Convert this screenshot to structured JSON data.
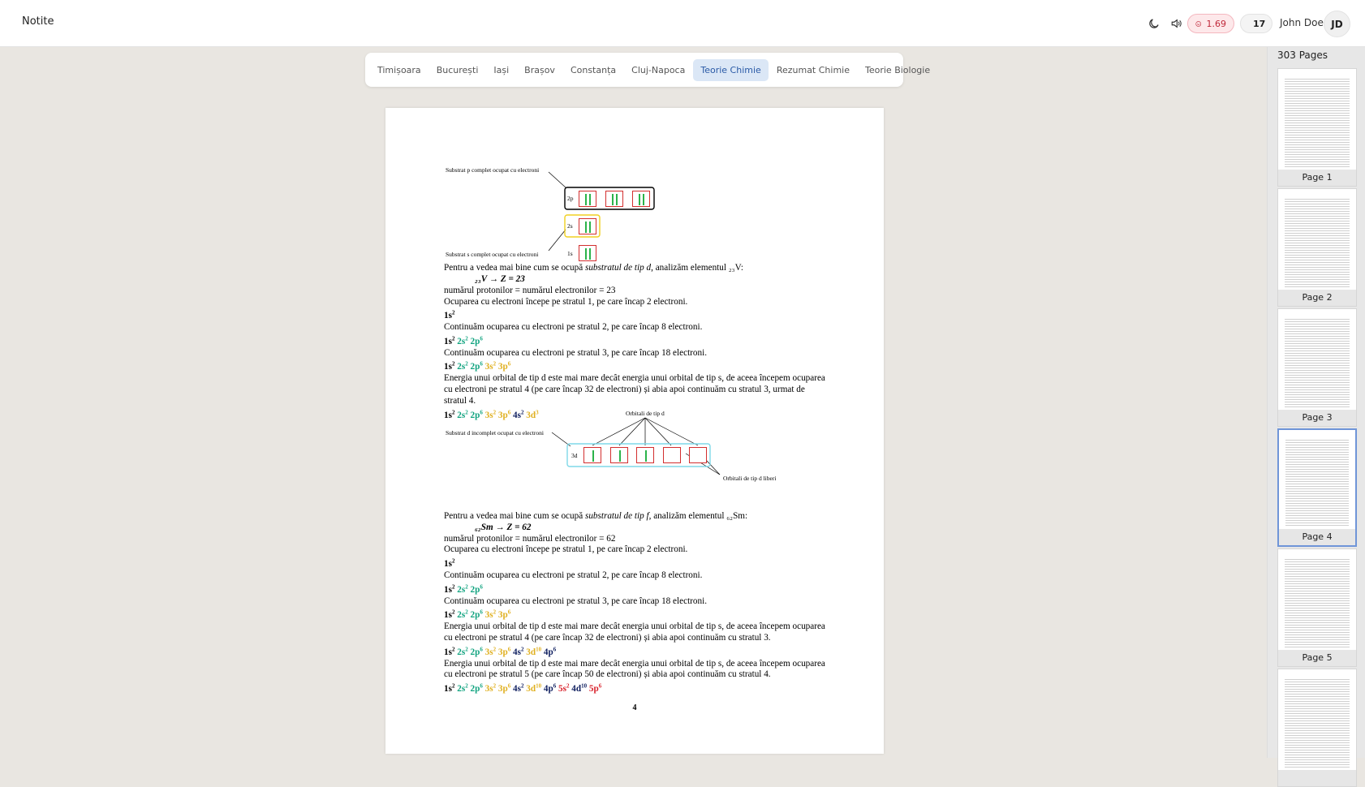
{
  "header": {
    "app_title": "Notite",
    "score": "1.69",
    "count": "17",
    "user_name": "John Doe",
    "user_initials": "JD",
    "icons": [
      "moon-icon",
      "speaker-icon",
      "sad-face-icon",
      "grid-icon"
    ]
  },
  "tabs": [
    {
      "label": "Timișoara",
      "active": false
    },
    {
      "label": "București",
      "active": false
    },
    {
      "label": "Iași",
      "active": false
    },
    {
      "label": "Brașov",
      "active": false
    },
    {
      "label": "Constanța",
      "active": false
    },
    {
      "label": "Cluj-Napoca",
      "active": false
    },
    {
      "label": "Teorie Chimie",
      "active": true
    },
    {
      "label": "Rezumat Chimie",
      "active": false
    },
    {
      "label": "Teorie Biologie",
      "active": false
    }
  ],
  "document": {
    "page_number": "4",
    "diagram1": {
      "label_p": "Substrat p complet ocupat cu electroni",
      "label_s": "Substrat s complet ocupat cu electroni",
      "sub_2p": "2p",
      "sub_2s": "2s",
      "sub_1s": "1s"
    },
    "diagram2": {
      "label_top": "Orbitali de tip d",
      "label_left": "Substrat d incomplet ocupat cu electroni",
      "label_right": "Orbitali de tip d liberi",
      "sub_3d": "3d"
    },
    "block1": {
      "intro_pre": "Pentru a vedea mai bine cum se ocupă ",
      "intro_em": "substratul de tip d",
      "intro_post": ", analizăm elementul ₂₃V:",
      "formula": "₂₃V → Z = 23",
      "protons": "numărul protonilor = numărul electronilor = 23",
      "s1": "Ocuparea cu electroni începe pe stratul 1, pe care încap 2 electroni.",
      "s2": "Continuăm ocuparea cu electroni pe stratul 2, pe care încap 8 electroni.",
      "s3": "Continuăm ocuparea cu electroni pe stratul 3, pe care încap 18 electroni.",
      "energy": "Energia unui orbital de tip d este mai mare decât energia unui orbital de tip s, de aceea începem ocuparea cu electroni pe stratul 4 (pe care încap 32 de electroni) și abia apoi continuăm cu stratul 3, urmat de stratul 4."
    },
    "block2": {
      "intro_pre": "Pentru a vedea mai bine cum se ocupă ",
      "intro_em": "substratul de tip f",
      "intro_post": ", analizăm elementul ₆₂Sm:",
      "formula": "₆₂Sm → Z = 62",
      "protons": "numărul protonilor = numărul electronilor = 62",
      "s1": "Ocuparea cu electroni începe pe stratul 1, pe care încap 2 electroni.",
      "s2": "Continuăm ocuparea cu electroni pe stratul 2, pe care încap 8 electroni.",
      "s3": "Continuăm ocuparea cu electroni pe stratul 3, pe care încap 18 electroni.",
      "energy1": "Energia unui orbital de tip d este mai mare decât energia unui orbital de tip s, de aceea începem ocuparea cu electroni pe stratul 4 (pe care încap 32 de electroni) și abia apoi continuăm cu stratul 3.",
      "energy2": "Energia unui orbital de tip d este mai mare decât energia unui orbital de tip s, de aceea începem ocuparea cu electroni pe stratul 5 (pe care încap 50 de electroni) și abia apoi continuăm cu stratul 4."
    },
    "configs": {
      "c1s": [
        {
          "t": "1s",
          "e": "2",
          "c": "blk"
        }
      ],
      "c2": [
        {
          "t": "1s",
          "e": "2",
          "c": "blk"
        },
        {
          "t": "2s",
          "e": "2",
          "c": "grn"
        },
        {
          "t": "2p",
          "e": "6",
          "c": "grn"
        }
      ],
      "c3": [
        {
          "t": "1s",
          "e": "2",
          "c": "blk"
        },
        {
          "t": "2s",
          "e": "2",
          "c": "grn"
        },
        {
          "t": "2p",
          "e": "6",
          "c": "grn"
        },
        {
          "t": "3s",
          "e": "2",
          "c": "yel"
        },
        {
          "t": "3p",
          "e": "6",
          "c": "yel"
        }
      ],
      "cV": [
        {
          "t": "1s",
          "e": "2",
          "c": "blk"
        },
        {
          "t": "2s",
          "e": "2",
          "c": "grn"
        },
        {
          "t": "2p",
          "e": "6",
          "c": "grn"
        },
        {
          "t": "3s",
          "e": "2",
          "c": "yel"
        },
        {
          "t": "3p",
          "e": "6",
          "c": "yel"
        },
        {
          "t": "4s",
          "e": "2",
          "c": "nav"
        },
        {
          "t": "3d",
          "e": "3",
          "c": "yel"
        }
      ],
      "cSm4": [
        {
          "t": "1s",
          "e": "2",
          "c": "blk"
        },
        {
          "t": "2s",
          "e": "2",
          "c": "grn"
        },
        {
          "t": "2p",
          "e": "6",
          "c": "grn"
        },
        {
          "t": "3s",
          "e": "2",
          "c": "yel"
        },
        {
          "t": "3p",
          "e": "6",
          "c": "yel"
        },
        {
          "t": "4s",
          "e": "2",
          "c": "nav"
        },
        {
          "t": "3d",
          "e": "10",
          "c": "yel"
        },
        {
          "t": "4p",
          "e": "6",
          "c": "nav"
        }
      ],
      "cSm5": [
        {
          "t": "1s",
          "e": "2",
          "c": "blk"
        },
        {
          "t": "2s",
          "e": "2",
          "c": "grn"
        },
        {
          "t": "2p",
          "e": "6",
          "c": "grn"
        },
        {
          "t": "3s",
          "e": "2",
          "c": "yel"
        },
        {
          "t": "3p",
          "e": "6",
          "c": "yel"
        },
        {
          "t": "4s",
          "e": "2",
          "c": "nav"
        },
        {
          "t": "3d",
          "e": "10",
          "c": "yel"
        },
        {
          "t": "4p",
          "e": "6",
          "c": "nav"
        },
        {
          "t": "5s",
          "e": "2",
          "c": "red"
        },
        {
          "t": "4d",
          "e": "10",
          "c": "nav"
        },
        {
          "t": "5p",
          "e": "6",
          "c": "red"
        }
      ]
    }
  },
  "sidebar": {
    "pages_count": "303 Pages",
    "thumbnails": [
      {
        "label": "Page 1",
        "active": false
      },
      {
        "label": "Page 2",
        "active": false
      },
      {
        "label": "Page 3",
        "active": false
      },
      {
        "label": "Page 4",
        "active": true
      },
      {
        "label": "Page 5",
        "active": false
      },
      {
        "label": "",
        "active": false
      }
    ]
  },
  "colors": {
    "accent": "#2a5aa6",
    "active_tab_bg": "#dbe7f6",
    "score_bg": "#fde8ea",
    "green": "#10a37f",
    "yellow": "#e0b020",
    "navy": "#102060",
    "red": "#d8202a"
  }
}
